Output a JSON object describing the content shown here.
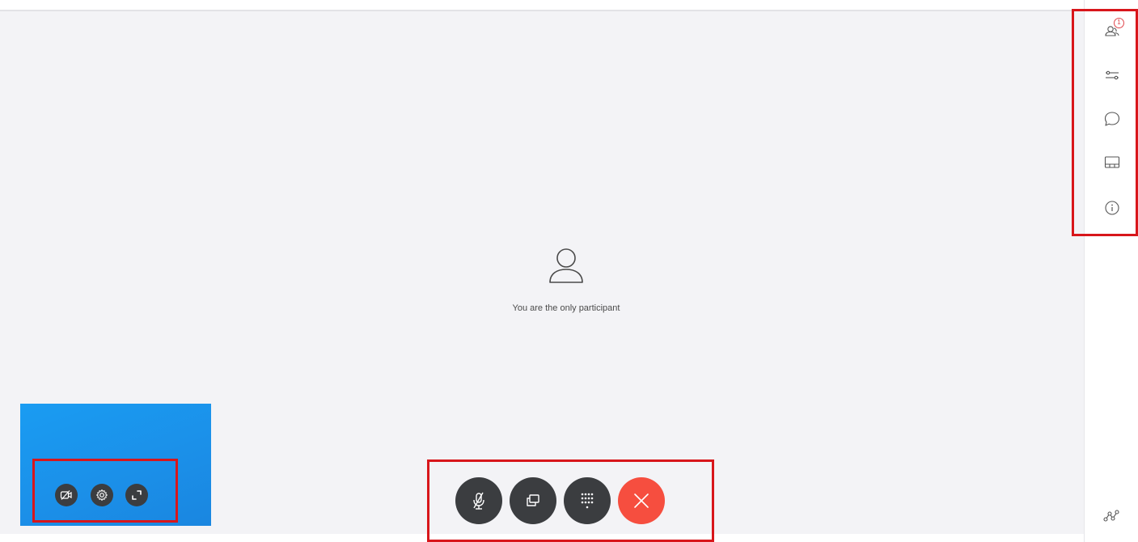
{
  "main": {
    "empty_message": "You are the only participant"
  },
  "sidebar": {
    "participants_badge": "1",
    "items": [
      {
        "name": "participants",
        "icon": "participants-icon"
      },
      {
        "name": "settings",
        "icon": "sliders-icon"
      },
      {
        "name": "chat",
        "icon": "chat-bubble-icon"
      },
      {
        "name": "layout",
        "icon": "layout-icon"
      },
      {
        "name": "info",
        "icon": "info-icon"
      }
    ],
    "bottom_icon": "network-icon"
  },
  "self_view": {
    "buttons": [
      {
        "name": "stop-video",
        "icon": "video-off-icon"
      },
      {
        "name": "settings",
        "icon": "gear-icon"
      },
      {
        "name": "expand",
        "icon": "expand-icon"
      }
    ]
  },
  "call_controls": {
    "buttons": [
      {
        "name": "mute",
        "icon": "microphone-muted-icon"
      },
      {
        "name": "share",
        "icon": "share-screen-icon"
      },
      {
        "name": "keypad",
        "icon": "keypad-icon"
      },
      {
        "name": "end-call",
        "icon": "close-icon"
      }
    ]
  },
  "colors": {
    "end_call": "#f64e3f",
    "control_bg": "#3b3d40",
    "highlight": "#d8161b",
    "self_view": "#1a9cf2",
    "badge": "#e0474c"
  }
}
